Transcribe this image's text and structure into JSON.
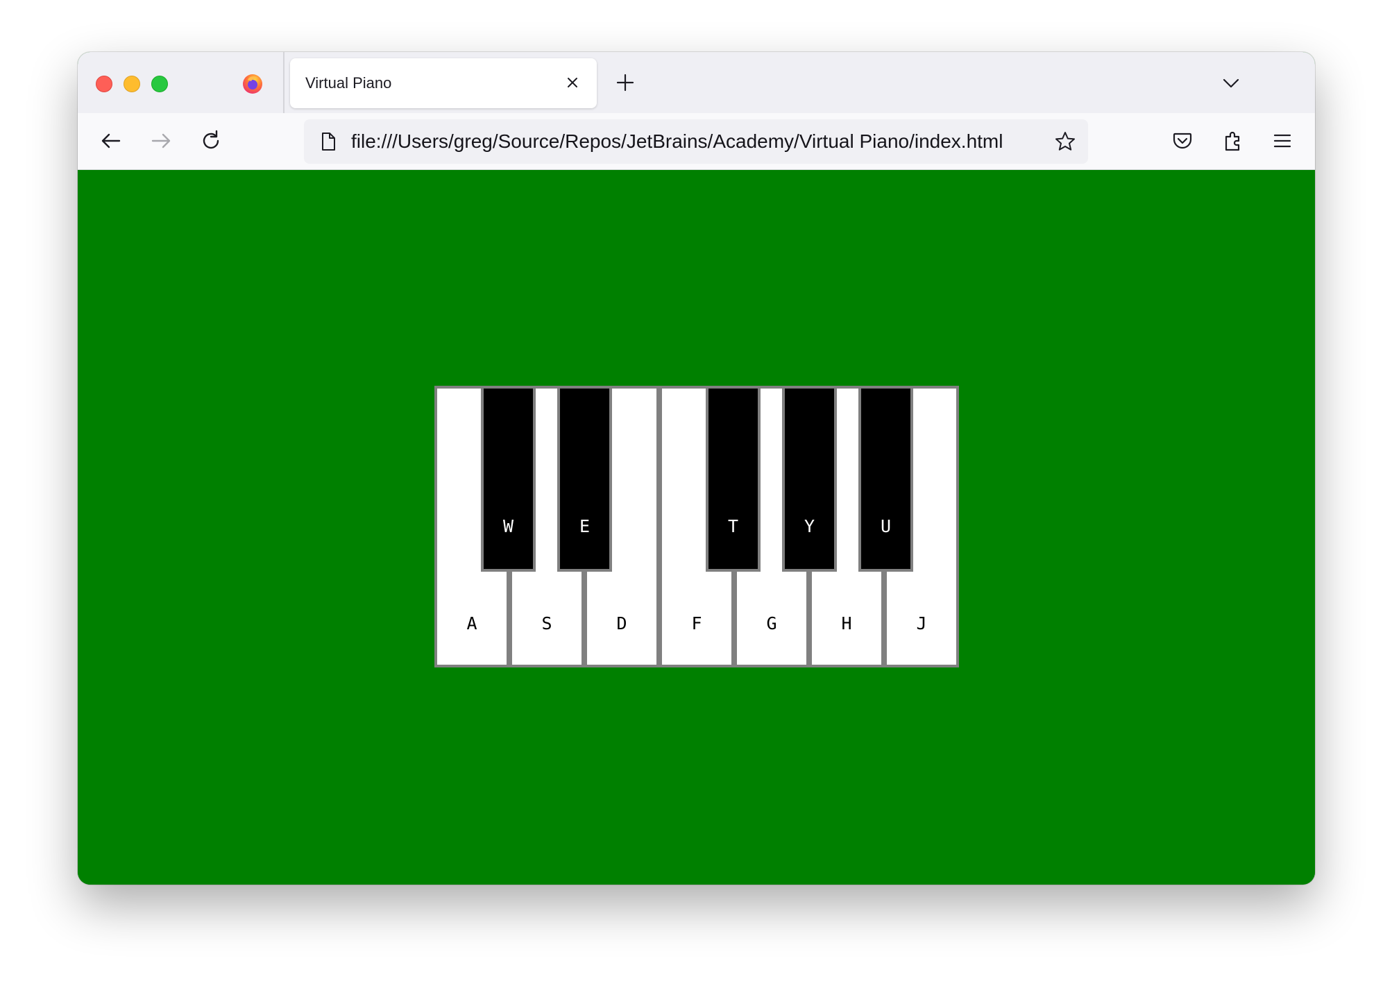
{
  "browser": {
    "tab": {
      "title": "Virtual Piano"
    },
    "url": "file:///Users/greg/Source/Repos/JetBrains/Academy/Virtual Piano/index.html",
    "icons": {
      "app": "firefox-icon",
      "tab_close": "close-icon",
      "new_tab": "plus-icon",
      "tab_list": "chevron-down-icon",
      "back": "arrow-left-icon",
      "forward": "arrow-right-icon",
      "reload": "reload-icon",
      "page": "page-icon",
      "bookmark": "star-icon",
      "pocket": "pocket-icon",
      "extensions": "puzzle-icon",
      "menu": "hamburger-icon"
    }
  },
  "page": {
    "background_color": "#008000",
    "piano": {
      "white_keys": [
        "A",
        "S",
        "D",
        "F",
        "G",
        "H",
        "J"
      ],
      "black_keys": [
        "W",
        "E",
        "T",
        "Y",
        "U"
      ],
      "white_key_color": "#ffffff",
      "black_key_color": "#000000",
      "border_color": "#808080"
    }
  }
}
